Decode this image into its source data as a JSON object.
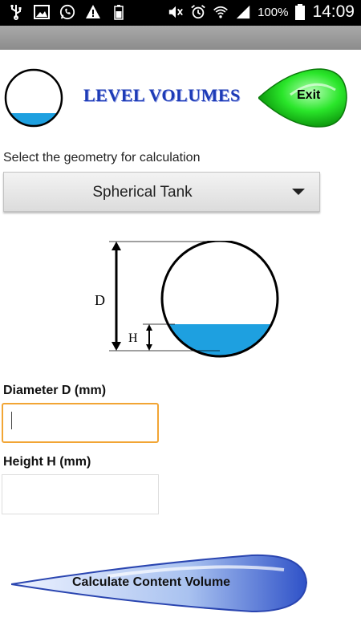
{
  "status_bar": {
    "battery_percent": "100%",
    "time": "14:09",
    "icons": [
      "usb-icon",
      "image-icon",
      "whatsapp-icon",
      "warning-icon",
      "battery-small-icon",
      "mute-icon",
      "alarm-icon",
      "wifi-icon",
      "signal-icon",
      "battery-icon"
    ]
  },
  "header": {
    "title": "LEVEL VOLUMES",
    "exit_label": "Exit"
  },
  "geometry": {
    "prompt": "Select the geometry for calculation",
    "selected": "Spherical Tank"
  },
  "diagram": {
    "d_label": "D",
    "h_label": "H",
    "liquid_color": "#1ea0e0"
  },
  "inputs": {
    "diameter_label": "Diameter D (mm)",
    "diameter_value": "",
    "height_label": "Height H (mm)",
    "height_value": ""
  },
  "actions": {
    "calculate_label": "Calculate Content Volume"
  },
  "colors": {
    "title_blue": "#1d3bb6",
    "exit_green": "#22dd22",
    "focus_orange": "#f2a534",
    "button_blue": "#3a5fd0"
  }
}
